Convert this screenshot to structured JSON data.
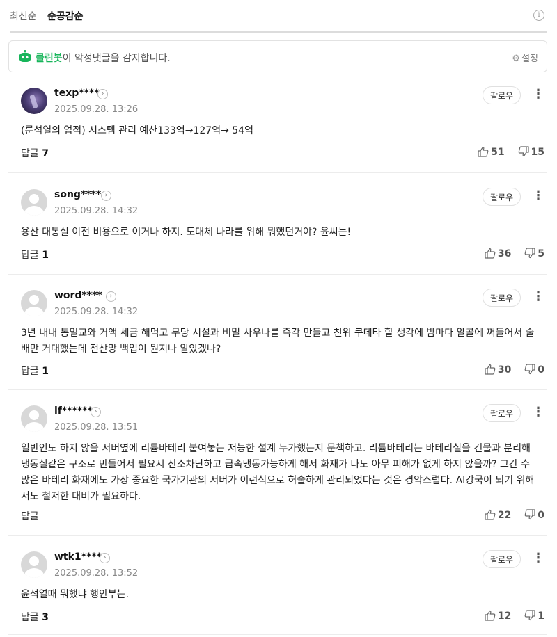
{
  "sort": {
    "tabs": [
      "최신순",
      "순공감순"
    ],
    "active_index": 1
  },
  "cleanbot": {
    "brand": "클린봇",
    "message": "이 악성댓글을 감지합니다.",
    "settings_label": "설정"
  },
  "labels": {
    "reply": "답글",
    "follow": "팔로우"
  },
  "colors": {
    "brand_green": "#17b55a"
  },
  "comments": [
    {
      "username": "texp****",
      "date": "2025.09.28. 13:26",
      "avatar": "photo",
      "text": "(룬석열의 업적) 시스템 관리 예산133억→127억→ 54억",
      "replies": "7",
      "likes": "51",
      "dislikes": "15"
    },
    {
      "username": "song****",
      "date": "2025.09.28. 14:32",
      "avatar": "default",
      "text": "용산 대통실 이전 비용으로 이거나 하지. 도대체 나라를 위해 뭐했던거야? 윤씨는!",
      "replies": "1",
      "likes": "36",
      "dislikes": "5"
    },
    {
      "username": "word****",
      "date": "2025.09.28. 14:32",
      "avatar": "default",
      "text": "3년 내내 통일교와 거액 세금 해먹고 무당 시설과 비밀 사우나를 즉각 만들고 친위 쿠데타 할 생각에 밤마다 알콜에 쩌들어서 술배만 거대했는데 전산망 백업이 뭔지나 알았겠나?",
      "replies": "1",
      "likes": "30",
      "dislikes": "0"
    },
    {
      "username": "if******",
      "date": "2025.09.28. 13:51",
      "avatar": "default",
      "text": "일반인도 하지 않을 서버옆에 리튬바테리 붙여놓는 저능한 설계 누가했는지 문책하고. 리튬바테리는 바테리실을 건물과 분리해 냉동실같은 구조로 만들어서 필요시 산소차단하고 급속냉동가능하게 해서 화재가 나도 아무 피해가 없게 하지 않을까? 그간 수많은 바테리 화재에도 가장 중요한 국가기관의 서버가 이런식으로 허술하게 관리되었다는 것은 경악스럽다. AI강국이 되기 위해서도 철저한 대비가 필요하다.",
      "replies": "",
      "likes": "22",
      "dislikes": "0"
    },
    {
      "username": "wtk1****",
      "date": "2025.09.28. 13:52",
      "avatar": "default",
      "text": "윤석열때 뭐했냐 행안부는.",
      "replies": "3",
      "likes": "12",
      "dislikes": "1"
    }
  ]
}
